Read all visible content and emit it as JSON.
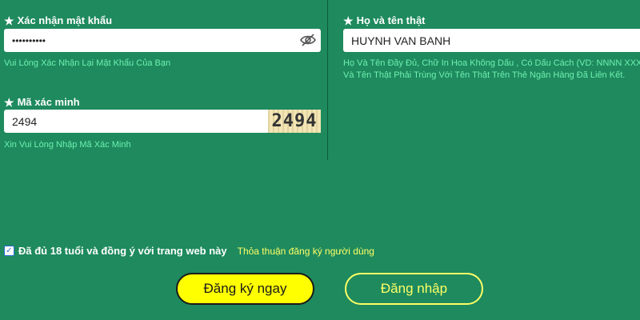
{
  "confirm_password": {
    "label": "Xác nhận mật khẩu",
    "value": "••••••••••",
    "hint": "Vui Lòng Xác Nhận Lại Mật Khẩu Của Bạn"
  },
  "real_name": {
    "label": "Họ và tên thật",
    "value": "HUYNH VAN BANH",
    "hint_line1": "Họ Và Tên Đầy Đủ, Chữ In Hoa Không Dấu , Có Dấu Cách (VD: NNNN XXX YY",
    "hint_line2": "Và Tên Thật Phải Trùng Với Tên Thật Trên Thẻ Ngân Hàng Đã Liên Kết."
  },
  "verification_code": {
    "label": "Mã xác minh",
    "value": "2494",
    "captcha_text": "2494",
    "hint": "Xin Vui Lòng Nhập Mã Xác Minh"
  },
  "agreement": {
    "checked": true,
    "checkmark": "✓",
    "text": "Đã đủ 18 tuổi và đồng ý với trang web này",
    "link": "Thỏa thuận đăng ký người dùng"
  },
  "buttons": {
    "register": "Đăng ký ngay",
    "login": "Đăng nhập"
  },
  "colors": {
    "background": "#1e8a5e",
    "hint_text": "#6ff0b0",
    "accent_yellow": "#ffff00",
    "link_yellow": "#ffff66"
  },
  "icons": {
    "star": "star-icon",
    "eye_slash": "eye-slash-icon",
    "check": "check-icon"
  }
}
